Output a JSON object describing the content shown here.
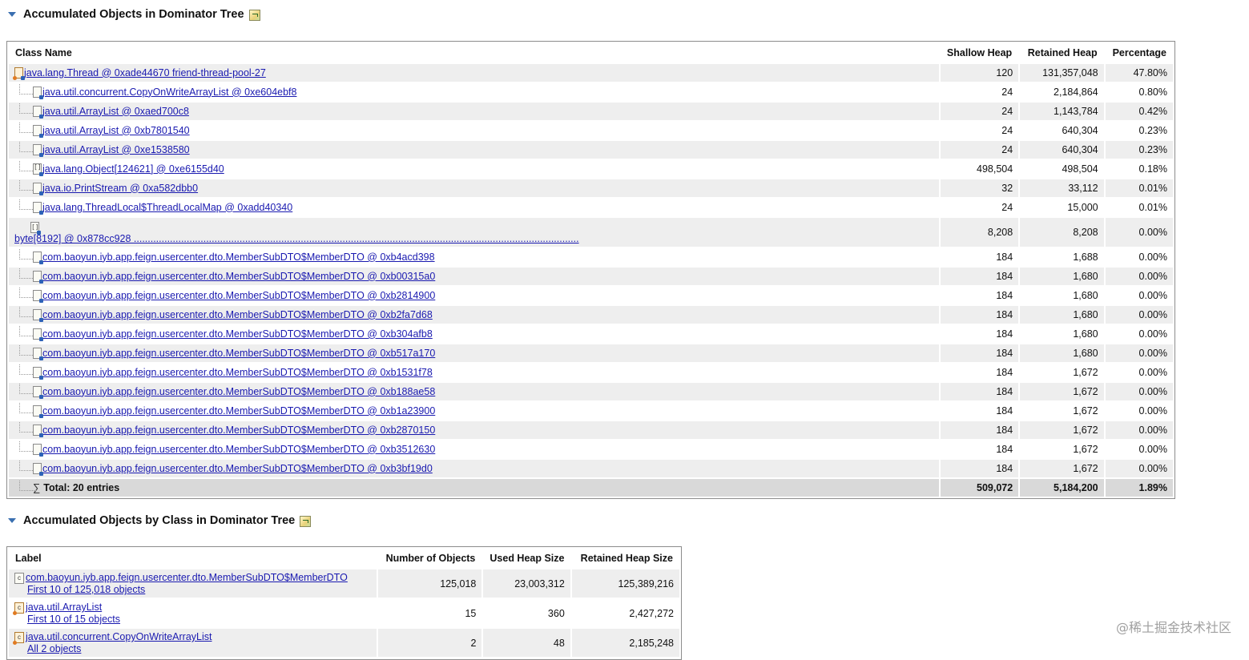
{
  "section1": {
    "title": "Accumulated Objects in Dominator Tree",
    "headers": [
      "Class Name",
      "Shallow Heap",
      "Retained Heap",
      "Percentage"
    ],
    "rows": [
      {
        "icon": "thread-object-icon",
        "name": "java.lang.Thread @ 0xade44670 friend-thread-pool-27",
        "shallow": "120",
        "retained": "131,357,048",
        "pct": "47.80%"
      },
      {
        "icon": "object-icon",
        "name": "java.util.concurrent.CopyOnWriteArrayList @ 0xe604ebf8",
        "shallow": "24",
        "retained": "2,184,864",
        "pct": "0.80%"
      },
      {
        "icon": "object-icon",
        "name": "java.util.ArrayList @ 0xaed700c8",
        "shallow": "24",
        "retained": "1,143,784",
        "pct": "0.42%"
      },
      {
        "icon": "object-icon",
        "name": "java.util.ArrayList @ 0xb7801540",
        "shallow": "24",
        "retained": "640,304",
        "pct": "0.23%"
      },
      {
        "icon": "object-icon",
        "name": "java.util.ArrayList @ 0xe1538580",
        "shallow": "24",
        "retained": "640,304",
        "pct": "0.23%"
      },
      {
        "icon": "array-icon",
        "name": "java.lang.Object[124621] @ 0xe6155d40",
        "shallow": "498,504",
        "retained": "498,504",
        "pct": "0.18%"
      },
      {
        "icon": "object-icon",
        "name": "java.io.PrintStream @ 0xa582dbb0",
        "shallow": "32",
        "retained": "33,112",
        "pct": "0.01%"
      },
      {
        "icon": "object-icon",
        "name": "java.lang.ThreadLocal$ThreadLocalMap @ 0xadd40340",
        "shallow": "24",
        "retained": "15,000",
        "pct": "0.01%"
      },
      {
        "icon": "array-icon",
        "name": "byte[8192] @ 0x878cc928 ................................................................................................................................................................",
        "shallow": "8,208",
        "retained": "8,208",
        "pct": "0.00%"
      },
      {
        "icon": "object-icon",
        "name": "com.baoyun.iyb.app.feign.usercenter.dto.MemberSubDTO$MemberDTO @ 0xb4acd398",
        "shallow": "184",
        "retained": "1,688",
        "pct": "0.00%"
      },
      {
        "icon": "object-icon",
        "name": "com.baoyun.iyb.app.feign.usercenter.dto.MemberSubDTO$MemberDTO @ 0xb00315a0",
        "shallow": "184",
        "retained": "1,680",
        "pct": "0.00%"
      },
      {
        "icon": "object-icon",
        "name": "com.baoyun.iyb.app.feign.usercenter.dto.MemberSubDTO$MemberDTO @ 0xb2814900",
        "shallow": "184",
        "retained": "1,680",
        "pct": "0.00%"
      },
      {
        "icon": "object-icon",
        "name": "com.baoyun.iyb.app.feign.usercenter.dto.MemberSubDTO$MemberDTO @ 0xb2fa7d68",
        "shallow": "184",
        "retained": "1,680",
        "pct": "0.00%"
      },
      {
        "icon": "object-icon",
        "name": "com.baoyun.iyb.app.feign.usercenter.dto.MemberSubDTO$MemberDTO @ 0xb304afb8",
        "shallow": "184",
        "retained": "1,680",
        "pct": "0.00%"
      },
      {
        "icon": "object-icon",
        "name": "com.baoyun.iyb.app.feign.usercenter.dto.MemberSubDTO$MemberDTO @ 0xb517a170",
        "shallow": "184",
        "retained": "1,680",
        "pct": "0.00%"
      },
      {
        "icon": "object-icon",
        "name": "com.baoyun.iyb.app.feign.usercenter.dto.MemberSubDTO$MemberDTO @ 0xb1531f78",
        "shallow": "184",
        "retained": "1,672",
        "pct": "0.00%"
      },
      {
        "icon": "object-icon",
        "name": "com.baoyun.iyb.app.feign.usercenter.dto.MemberSubDTO$MemberDTO @ 0xb188ae58",
        "shallow": "184",
        "retained": "1,672",
        "pct": "0.00%"
      },
      {
        "icon": "object-icon",
        "name": "com.baoyun.iyb.app.feign.usercenter.dto.MemberSubDTO$MemberDTO @ 0xb1a23900",
        "shallow": "184",
        "retained": "1,672",
        "pct": "0.00%"
      },
      {
        "icon": "object-icon",
        "name": "com.baoyun.iyb.app.feign.usercenter.dto.MemberSubDTO$MemberDTO @ 0xb2870150",
        "shallow": "184",
        "retained": "1,672",
        "pct": "0.00%"
      },
      {
        "icon": "object-icon",
        "name": "com.baoyun.iyb.app.feign.usercenter.dto.MemberSubDTO$MemberDTO @ 0xb3512630",
        "shallow": "184",
        "retained": "1,672",
        "pct": "0.00%"
      },
      {
        "icon": "object-icon",
        "name": "com.baoyun.iyb.app.feign.usercenter.dto.MemberSubDTO$MemberDTO @ 0xb3bf19d0",
        "shallow": "184",
        "retained": "1,672",
        "pct": "0.00%"
      }
    ],
    "total": {
      "symbol": "∑",
      "label": "Total: 20 entries",
      "shallow": "509,072",
      "retained": "5,184,200",
      "pct": "1.89%"
    }
  },
  "section2": {
    "title": "Accumulated Objects by Class in Dominator Tree",
    "headers": [
      "Label",
      "Number of Objects",
      "Used Heap Size",
      "Retained Heap Size"
    ],
    "rows": [
      {
        "icon": "class-icon",
        "label": "com.baoyun.iyb.app.feign.usercenter.dto.MemberSubDTO$MemberDTO",
        "sub": "First 10 of 125,018 objects",
        "count": "125,018",
        "used": "23,003,312",
        "retained": "125,389,216"
      },
      {
        "icon": "class-icon",
        "label": "java.util.ArrayList",
        "sub": "First 10 of 15 objects",
        "count": "15",
        "used": "360",
        "retained": "2,427,272"
      },
      {
        "icon": "class-icon",
        "label": "java.util.concurrent.CopyOnWriteArrayList",
        "sub": "All 2 objects",
        "count": "2",
        "used": "48",
        "retained": "2,185,248"
      }
    ]
  },
  "watermark": "@稀土掘金技术社区"
}
